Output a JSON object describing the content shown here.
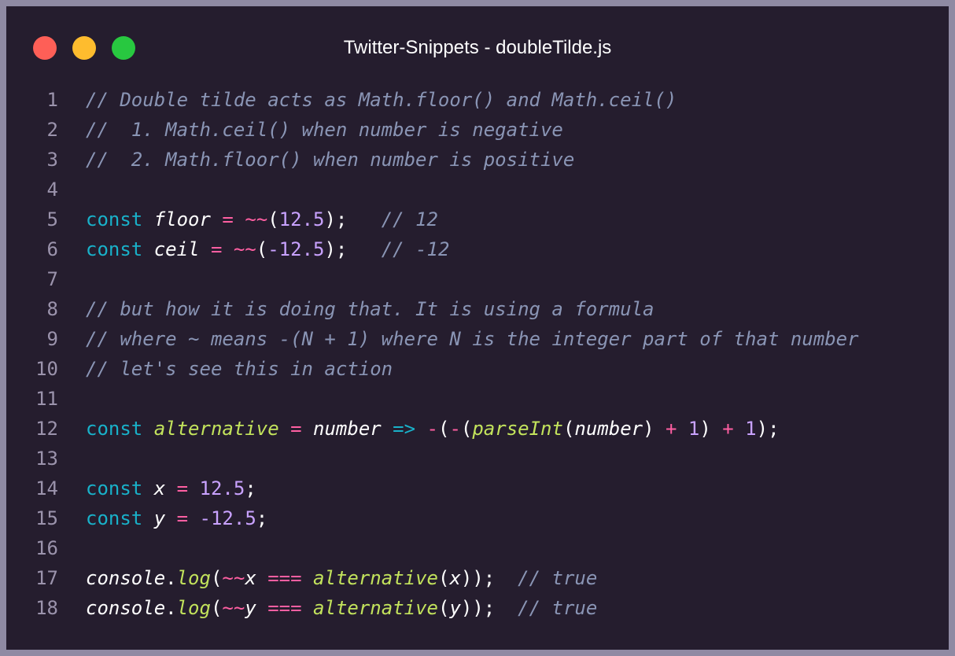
{
  "window": {
    "title": "Twitter-Snippets - doubleTilde.js",
    "controls": [
      "close",
      "minimize",
      "maximize"
    ]
  },
  "colors": {
    "background": "#251d2e",
    "comment": "#8a95b5",
    "keyword": "#19b1c9",
    "operator": "#ff5fa2",
    "number": "#c9a2ff",
    "function": "#c3e35c"
  },
  "code": {
    "lines": [
      {
        "n": "1",
        "tokens": [
          {
            "t": "// Double tilde acts as Math.floor() and Math.ceil()",
            "c": "cm"
          }
        ]
      },
      {
        "n": "2",
        "tokens": [
          {
            "t": "//  1. Math.ceil() when number is negative",
            "c": "cm"
          }
        ]
      },
      {
        "n": "3",
        "tokens": [
          {
            "t": "//  2. Math.floor() when number is positive",
            "c": "cm"
          }
        ]
      },
      {
        "n": "4",
        "tokens": []
      },
      {
        "n": "5",
        "tokens": [
          {
            "t": "const",
            "c": "kw"
          },
          {
            "t": " ",
            "c": "p"
          },
          {
            "t": "floor",
            "c": "vi"
          },
          {
            "t": " ",
            "c": "p"
          },
          {
            "t": "=",
            "c": "op"
          },
          {
            "t": " ",
            "c": "p"
          },
          {
            "t": "~~",
            "c": "op"
          },
          {
            "t": "(",
            "c": "p"
          },
          {
            "t": "12.5",
            "c": "num"
          },
          {
            "t": ");   ",
            "c": "p"
          },
          {
            "t": "// 12",
            "c": "cm"
          }
        ]
      },
      {
        "n": "6",
        "tokens": [
          {
            "t": "const",
            "c": "kw"
          },
          {
            "t": " ",
            "c": "p"
          },
          {
            "t": "ceil",
            "c": "vi"
          },
          {
            "t": " ",
            "c": "p"
          },
          {
            "t": "=",
            "c": "op"
          },
          {
            "t": " ",
            "c": "p"
          },
          {
            "t": "~~",
            "c": "op"
          },
          {
            "t": "(",
            "c": "p"
          },
          {
            "t": "-12.5",
            "c": "num"
          },
          {
            "t": ");   ",
            "c": "p"
          },
          {
            "t": "// -12",
            "c": "cm"
          }
        ]
      },
      {
        "n": "7",
        "tokens": []
      },
      {
        "n": "8",
        "tokens": [
          {
            "t": "// but how it is doing that. It is using a formula",
            "c": "cm"
          }
        ]
      },
      {
        "n": "9",
        "tokens": [
          {
            "t": "// where ~ means -(N + 1) where N is the integer part of that number",
            "c": "cm"
          }
        ]
      },
      {
        "n": "10",
        "tokens": [
          {
            "t": "// let's see this in action",
            "c": "cm"
          }
        ]
      },
      {
        "n": "11",
        "tokens": []
      },
      {
        "n": "12",
        "tokens": [
          {
            "t": "const",
            "c": "kw"
          },
          {
            "t": " ",
            "c": "p"
          },
          {
            "t": "alternative",
            "c": "fn"
          },
          {
            "t": " ",
            "c": "p"
          },
          {
            "t": "=",
            "c": "op"
          },
          {
            "t": " ",
            "c": "p"
          },
          {
            "t": "number",
            "c": "vi"
          },
          {
            "t": " ",
            "c": "p"
          },
          {
            "t": "=>",
            "c": "kw"
          },
          {
            "t": " ",
            "c": "p"
          },
          {
            "t": "-",
            "c": "op"
          },
          {
            "t": "(",
            "c": "p"
          },
          {
            "t": "-",
            "c": "op"
          },
          {
            "t": "(",
            "c": "p"
          },
          {
            "t": "parseInt",
            "c": "fn"
          },
          {
            "t": "(",
            "c": "p"
          },
          {
            "t": "number",
            "c": "vi"
          },
          {
            "t": ") ",
            "c": "p"
          },
          {
            "t": "+",
            "c": "op"
          },
          {
            "t": " ",
            "c": "p"
          },
          {
            "t": "1",
            "c": "num"
          },
          {
            "t": ") ",
            "c": "p"
          },
          {
            "t": "+",
            "c": "op"
          },
          {
            "t": " ",
            "c": "p"
          },
          {
            "t": "1",
            "c": "num"
          },
          {
            "t": ");",
            "c": "p"
          }
        ]
      },
      {
        "n": "13",
        "tokens": []
      },
      {
        "n": "14",
        "tokens": [
          {
            "t": "const",
            "c": "kw"
          },
          {
            "t": " ",
            "c": "p"
          },
          {
            "t": "x",
            "c": "vi"
          },
          {
            "t": " ",
            "c": "p"
          },
          {
            "t": "=",
            "c": "op"
          },
          {
            "t": " ",
            "c": "p"
          },
          {
            "t": "12.5",
            "c": "num"
          },
          {
            "t": ";",
            "c": "p"
          }
        ]
      },
      {
        "n": "15",
        "tokens": [
          {
            "t": "const",
            "c": "kw"
          },
          {
            "t": " ",
            "c": "p"
          },
          {
            "t": "y",
            "c": "vi"
          },
          {
            "t": " ",
            "c": "p"
          },
          {
            "t": "=",
            "c": "op"
          },
          {
            "t": " ",
            "c": "p"
          },
          {
            "t": "-12.5",
            "c": "num"
          },
          {
            "t": ";",
            "c": "p"
          }
        ]
      },
      {
        "n": "16",
        "tokens": []
      },
      {
        "n": "17",
        "tokens": [
          {
            "t": "console",
            "c": "vi"
          },
          {
            "t": ".",
            "c": "p"
          },
          {
            "t": "log",
            "c": "fn"
          },
          {
            "t": "(",
            "c": "p"
          },
          {
            "t": "~~",
            "c": "op"
          },
          {
            "t": "x",
            "c": "vi"
          },
          {
            "t": " ",
            "c": "p"
          },
          {
            "t": "===",
            "c": "op"
          },
          {
            "t": " ",
            "c": "p"
          },
          {
            "t": "alternative",
            "c": "fn"
          },
          {
            "t": "(",
            "c": "p"
          },
          {
            "t": "x",
            "c": "vi"
          },
          {
            "t": "));  ",
            "c": "p"
          },
          {
            "t": "// true",
            "c": "cm"
          }
        ]
      },
      {
        "n": "18",
        "tokens": [
          {
            "t": "console",
            "c": "vi"
          },
          {
            "t": ".",
            "c": "p"
          },
          {
            "t": "log",
            "c": "fn"
          },
          {
            "t": "(",
            "c": "p"
          },
          {
            "t": "~~",
            "c": "op"
          },
          {
            "t": "y",
            "c": "vi"
          },
          {
            "t": " ",
            "c": "p"
          },
          {
            "t": "===",
            "c": "op"
          },
          {
            "t": " ",
            "c": "p"
          },
          {
            "t": "alternative",
            "c": "fn"
          },
          {
            "t": "(",
            "c": "p"
          },
          {
            "t": "y",
            "c": "vi"
          },
          {
            "t": "));  ",
            "c": "p"
          },
          {
            "t": "// true",
            "c": "cm"
          }
        ]
      }
    ]
  }
}
